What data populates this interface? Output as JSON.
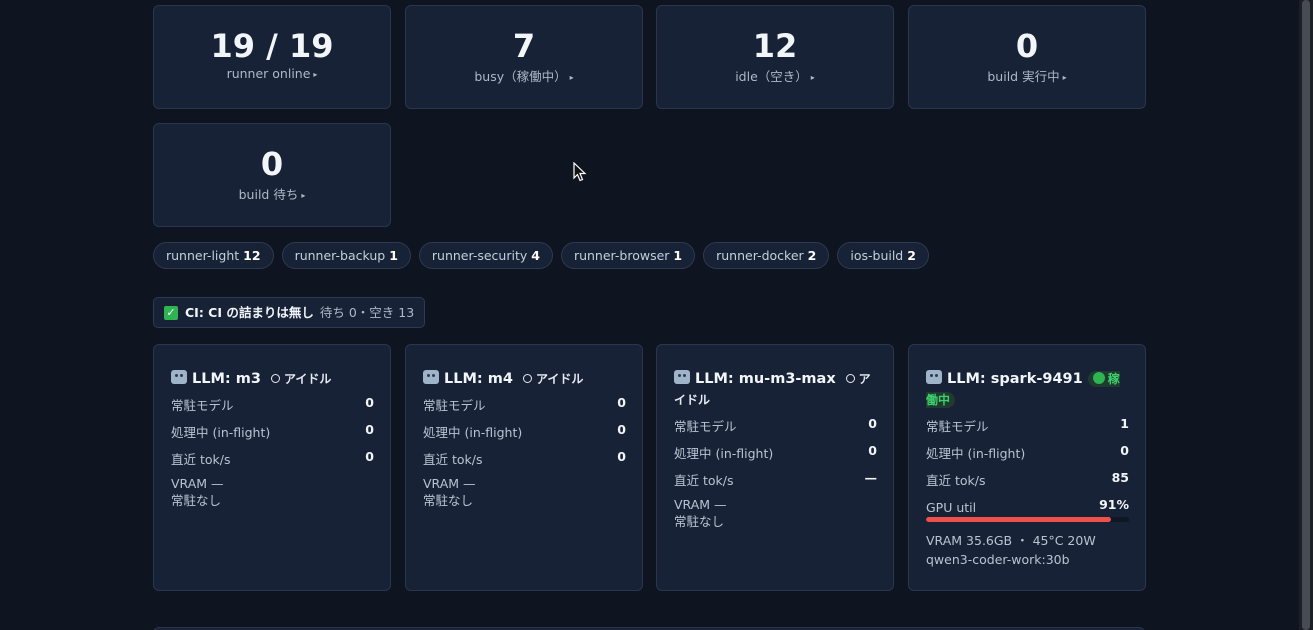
{
  "stats": [
    {
      "value": "19 / 19",
      "label": "runner online"
    },
    {
      "value": "7",
      "label": "busy（稼働中）"
    },
    {
      "value": "12",
      "label": "idle（空き）"
    },
    {
      "value": "0",
      "label": "build 実行中"
    },
    {
      "value": "0",
      "label": "build 待ち"
    }
  ],
  "caret": "▸",
  "runner_labels": [
    {
      "name": "runner-light",
      "count": "12"
    },
    {
      "name": "runner-backup",
      "count": "1"
    },
    {
      "name": "runner-security",
      "count": "4"
    },
    {
      "name": "runner-browser",
      "count": "1"
    },
    {
      "name": "runner-docker",
      "count": "2"
    },
    {
      "name": "ios-build",
      "count": "2"
    }
  ],
  "ci": {
    "title": "CI: CI の詰まりは無し",
    "detail": "待ち 0・空き 13",
    "icon": "check-icon"
  },
  "llm": [
    {
      "name": "LLM: m3",
      "status": "アイドル",
      "resident_label": "常駐モデル",
      "resident": "0",
      "inflight_label": "処理中 (in-flight)",
      "inflight": "0",
      "toks_label": "直近 tok/s",
      "toks": "0",
      "vram": "VRAM —",
      "model": "常駐なし"
    },
    {
      "name": "LLM: m4",
      "status": "アイドル",
      "resident_label": "常駐モデル",
      "resident": "0",
      "inflight_label": "処理中 (in-flight)",
      "inflight": "0",
      "toks_label": "直近 tok/s",
      "toks": "0",
      "vram": "VRAM —",
      "model": "常駐なし"
    },
    {
      "name": "LLM: mu-m3-max",
      "status": "アイドル",
      "resident_label": "常駐モデル",
      "resident": "0",
      "inflight_label": "処理中 (in-flight)",
      "inflight": "0",
      "toks_label": "直近 tok/s",
      "toks": "—",
      "vram": "VRAM —",
      "model": "常駐なし"
    },
    {
      "name": "LLM: spark-9491",
      "status": "稼働中",
      "resident_label": "常駐モデル",
      "resident": "1",
      "inflight_label": "処理中 (in-flight)",
      "inflight": "0",
      "toks_label": "直近 tok/s",
      "toks": "85",
      "gpu_label": "GPU util",
      "gpu": "91%",
      "gpu_fraction": 0.91,
      "vram": "VRAM 35.6GB ・ 45°C 20W",
      "model": "qwen3-coder-work:30b"
    }
  ],
  "colors": {
    "background": "#0e1420",
    "card": "#172236",
    "gpu_bar": "#f0504a",
    "active": "#3ccf6b"
  }
}
